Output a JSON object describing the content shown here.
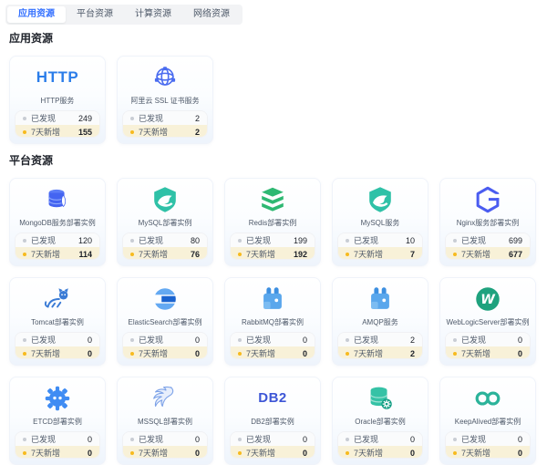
{
  "tabs": {
    "items": [
      {
        "label": "应用资源",
        "active": true
      },
      {
        "label": "平台资源",
        "active": false
      },
      {
        "label": "计算资源",
        "active": false
      },
      {
        "label": "网络资源",
        "active": false
      }
    ]
  },
  "stats_labels": {
    "discovered": "已发现",
    "new7d": "7天新增"
  },
  "colors": {
    "accent_blue": "#3370ff",
    "new7d_row_bg": "#f8f1d8",
    "new7d_dot": "#f7ba1e",
    "discovered_dot": "#c9cdd4",
    "tabbar_bg": "#f2f3f5"
  },
  "sections": [
    {
      "title": "应用资源",
      "cards": [
        {
          "name": "HTTP服务",
          "icon": "http-logo",
          "logo_text": "HTTP",
          "discovered": "249",
          "new7d": "155"
        },
        {
          "name": "阿里云 SSL 证书服务",
          "icon": "ssl-cert-icon",
          "discovered": "2",
          "new7d": "2"
        }
      ]
    },
    {
      "title": "平台资源",
      "cards": [
        {
          "name": "MongoDB服务部署实例",
          "icon": "mongodb-icon",
          "discovered": "120",
          "new7d": "114"
        },
        {
          "name": "MySQL部署实例",
          "icon": "mysql-icon",
          "discovered": "80",
          "new7d": "76"
        },
        {
          "name": "Redis部署实例",
          "icon": "redis-icon",
          "discovered": "199",
          "new7d": "192"
        },
        {
          "name": "MySQL服务",
          "icon": "mysql-icon",
          "discovered": "10",
          "new7d": "7"
        },
        {
          "name": "Nginx服务部署实例",
          "icon": "nginx-icon",
          "discovered": "699",
          "new7d": "677"
        },
        {
          "name": "Tomcat部署实例",
          "icon": "tomcat-icon",
          "discovered": "0",
          "new7d": "0"
        },
        {
          "name": "ElasticSearch部署实例",
          "icon": "elasticsearch-icon",
          "discovered": "0",
          "new7d": "0"
        },
        {
          "name": "RabbitMQ部署实例",
          "icon": "rabbitmq-icon",
          "discovered": "0",
          "new7d": "0"
        },
        {
          "name": "AMQP服务",
          "icon": "rabbitmq-icon",
          "discovered": "2",
          "new7d": "2"
        },
        {
          "name": "WebLogicServer部署实例",
          "icon": "weblogic-icon",
          "discovered": "0",
          "new7d": "0"
        },
        {
          "name": "ETCD部署实例",
          "icon": "etcd-icon",
          "discovered": "0",
          "new7d": "0"
        },
        {
          "name": "MSSQL部署实例",
          "icon": "mssql-icon",
          "discovered": "0",
          "new7d": "0"
        },
        {
          "name": "DB2部署实例",
          "icon": "db2-logo",
          "logo_text": "DB2",
          "discovered": "0",
          "new7d": "0"
        },
        {
          "name": "Oracle部署实例",
          "icon": "oracle-icon",
          "discovered": "0",
          "new7d": "0"
        },
        {
          "name": "KeepAlived部署实例",
          "icon": "keepalived-icon",
          "discovered": "0",
          "new7d": "0"
        }
      ]
    }
  ]
}
